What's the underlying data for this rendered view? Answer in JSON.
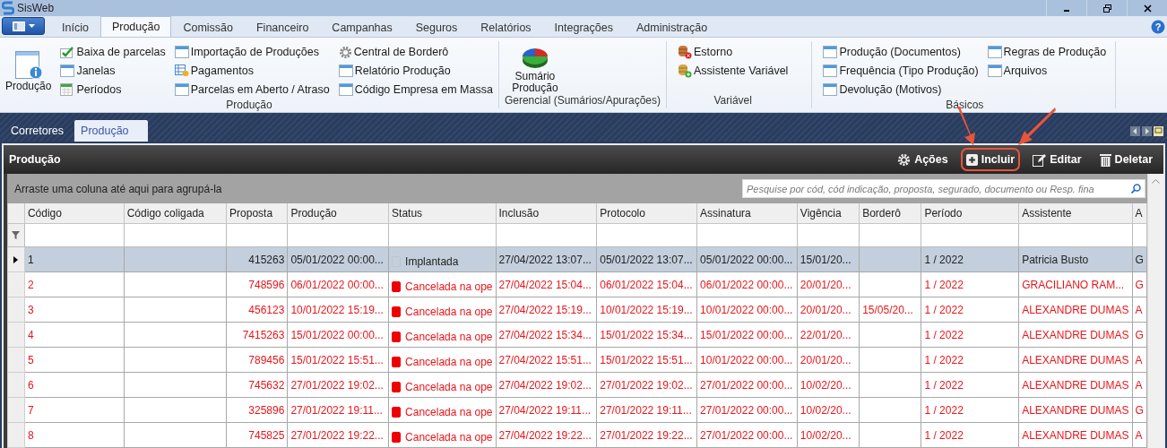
{
  "window": {
    "title": "SisWeb"
  },
  "menu_tabs": [
    {
      "label": "Início",
      "selected": false
    },
    {
      "label": "Produção",
      "selected": true
    },
    {
      "label": "Comissão",
      "selected": false
    },
    {
      "label": "Financeiro",
      "selected": false
    },
    {
      "label": "Campanhas",
      "selected": false
    },
    {
      "label": "Seguros",
      "selected": false
    },
    {
      "label": "Relatórios",
      "selected": false
    },
    {
      "label": "Integrações",
      "selected": false
    },
    {
      "label": "Administração",
      "selected": false
    }
  ],
  "help_label": "?",
  "ribbon": {
    "groups": [
      {
        "title": "Produção",
        "large_button": {
          "label": "Produção"
        },
        "columns": [
          [
            "Baixa de parcelas",
            "Janelas",
            "Períodos"
          ],
          [
            "Importação de Produções",
            "Pagamentos",
            "Parcelas em Aberto / Atraso"
          ],
          [
            "Central de Borderô",
            "Relatório Produção",
            "Código Empresa em Massa"
          ]
        ]
      },
      {
        "title": "Gerencial (Sumários/Apurações)",
        "large_button": {
          "label": "Sumário Produção"
        }
      },
      {
        "title": "Variável",
        "columns": [
          [
            "Estorno",
            "Assistente Variável"
          ]
        ]
      },
      {
        "title": "Básicos",
        "columns": [
          [
            "Produção (Documentos)",
            "Frequência (Tipo Produção)",
            "Devolução (Motivos)"
          ],
          [
            "Regras de Produção",
            "Arquivos"
          ]
        ]
      }
    ]
  },
  "document_tabs": [
    {
      "label": "Corretores",
      "selected": false
    },
    {
      "label": "Produção",
      "selected": true
    }
  ],
  "panel": {
    "title": "Produção",
    "actions": [
      {
        "label": "Ações",
        "highlighted": false
      },
      {
        "label": "Incluir",
        "highlighted": true
      },
      {
        "label": "Editar",
        "highlighted": false
      },
      {
        "label": "Deletar",
        "highlighted": false
      }
    ],
    "group_hint": "Arraste uma coluna até aqui para agrupá-la",
    "search": {
      "placeholder": "Pesquise por cód, cód indicação, proposta, segurado, documento ou Resp. fina"
    }
  },
  "table": {
    "columns": [
      "Código",
      "Código coligada",
      "Proposta",
      "Produção",
      "Status",
      "Inclusão",
      "Protocolo",
      "Assinatura",
      "Vigência",
      "Borderô",
      "Período",
      "Assistente",
      "A"
    ],
    "rows": [
      {
        "selected": true,
        "cancelled": false,
        "cells": [
          "1",
          null,
          "415263",
          "05/01/2022 00:00...",
          "Implantada",
          "27/04/2022 13:07...",
          "05/01/2022 13:07...",
          "05/01/2022 00:00...",
          "15/01/20...",
          null,
          "1 / 2022",
          "Patricia Busto",
          "G"
        ]
      },
      {
        "selected": false,
        "cancelled": true,
        "cells": [
          "2",
          null,
          "748596",
          "06/01/2022 00:00...",
          "Cancelada na ope",
          "27/04/2022 15:04...",
          "06/01/2022 15:04...",
          "06/01/2022 00:00...",
          "20/01/20...",
          null,
          "1 / 2022",
          "GRACILIANO RAM...",
          "G"
        ]
      },
      {
        "selected": false,
        "cancelled": true,
        "cells": [
          "3",
          null,
          "456123",
          "10/01/2022 15:19...",
          "Cancelada na ope",
          "27/04/2022 15:19...",
          "10/01/2022 15:19...",
          "10/01/2022 00:00...",
          "20/01/20...",
          "15/05/20...",
          "1 / 2022",
          "ALEXANDRE DUMAS",
          "A"
        ]
      },
      {
        "selected": false,
        "cancelled": true,
        "cells": [
          "4",
          null,
          "7415263",
          "15/01/2022 00:00...",
          "Cancelada na ope",
          "27/04/2022 15:34...",
          "15/01/2022 15:34...",
          "15/01/2022 00:00...",
          "22/01/20...",
          null,
          "1 / 2022",
          "ALEXANDRE DUMAS",
          "G"
        ]
      },
      {
        "selected": false,
        "cancelled": true,
        "cells": [
          "5",
          null,
          "789456",
          "15/01/2022 15:51...",
          "Cancelada na ope",
          "27/04/2022 15:51...",
          "15/01/2022 15:51...",
          "10/01/2022 00:00...",
          "20/01/20...",
          null,
          "1 / 2022",
          "ALEXANDRE DUMAS",
          "A"
        ]
      },
      {
        "selected": false,
        "cancelled": true,
        "cells": [
          "6",
          null,
          "745632",
          "27/01/2022 19:02...",
          "Cancelada na ope",
          "27/04/2022 19:02...",
          "27/01/2022 19:02...",
          "27/01/2022 00:00...",
          "10/02/20...",
          null,
          "1 / 2022",
          "ALEXANDRE DUMAS",
          "A"
        ]
      },
      {
        "selected": false,
        "cancelled": true,
        "cells": [
          "7",
          null,
          "325896",
          "27/01/2022 19:11...",
          "Cancelada na ope",
          "27/04/2022 19:11...",
          "27/01/2022 19:11...",
          "27/01/2022 00:00...",
          "10/02/20...",
          null,
          "1 / 2022",
          "ALEXANDRE DUMAS",
          "G"
        ]
      },
      {
        "selected": false,
        "cancelled": true,
        "cells": [
          "8",
          null,
          "745825",
          "27/01/2022 19:22...",
          "Cancelada na ope",
          "27/04/2022 19:22...",
          "27/01/2022 19:22...",
          "27/01/2022 00:00...",
          "10/02/20...",
          null,
          "1 / 2022",
          "ALEXANDRE DUMAS",
          "A"
        ]
      }
    ]
  }
}
